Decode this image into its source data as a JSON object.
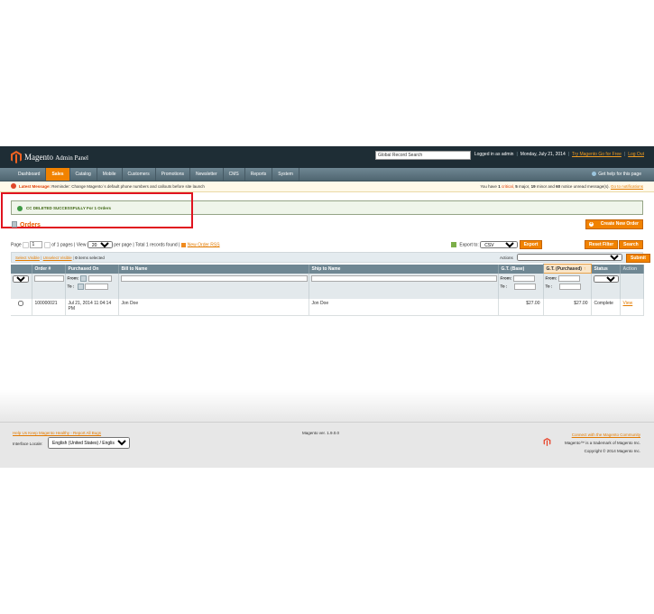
{
  "header": {
    "brand": "Magento",
    "brand_sub": "Admin Panel",
    "search_value": "Global Record Search",
    "logged_in": "Logged in as admin",
    "date": "Monday, July 21, 2014",
    "try_link": "Try Magento Go for Free",
    "logout": "Log Out"
  },
  "nav": {
    "items": [
      "Dashboard",
      "Sales",
      "Catalog",
      "Mobile",
      "Customers",
      "Promotions",
      "Newsletter",
      "CMS",
      "Reports",
      "System"
    ],
    "active": "Sales",
    "help": "Get help for this page"
  },
  "notice": {
    "label": "Latest Message:",
    "text": "Reminder: Change Magento`s default phone numbers and callouts before site launch",
    "right_prefix": "You have",
    "critical_count": "1",
    "critical_label": "critical,",
    "major_count": "5",
    "major_label": "major,",
    "minor_count": "19",
    "minor_label": "minor and",
    "notice_count": "60",
    "notice_label": "notice unread message(s).",
    "goto_link": "Go to notifications"
  },
  "success_message": "CC DELETED SUCCESSFULLY For 1 Orders",
  "page": {
    "title": "Orders",
    "create_button": "Create New Order"
  },
  "pager": {
    "page_label": "Page",
    "page_value": "1",
    "of_pages": "of 1 pages",
    "view_label": "View",
    "per_page_value": "20",
    "per_page_label": "per page",
    "records": "Total 1 records found",
    "rss_link": "New Order RSS"
  },
  "export": {
    "label": "Export to:",
    "format": "CSV",
    "button": "Export"
  },
  "buttons": {
    "reset": "Reset Filter",
    "search": "Search",
    "submit": "Submit"
  },
  "massaction": {
    "select_visible": "Select Visible",
    "unselect_visible": "Unselect Visible",
    "items_selected_count": "0",
    "items_selected_label": "items selected",
    "actions_label": "Actions",
    "actions_value": ""
  },
  "grid": {
    "columns": [
      "",
      "Order #",
      "Purchased On",
      "Bill to Name",
      "Ship to Name",
      "G.T. (Base)",
      "G.T. (Purchased)",
      "Status",
      "Action"
    ],
    "filter_any": "Any",
    "from_label": "From:",
    "to_label": "To :",
    "rows": [
      {
        "order": "100000021",
        "purchased_on": "Jul 21, 2014 11:04:14 PM",
        "bill_to": "Jon Doe",
        "ship_to": "Jon Doe",
        "gt_base": "$27.00",
        "gt_purchased": "$27.00",
        "status": "Complete",
        "action": "View"
      }
    ]
  },
  "footer": {
    "help_link": "Help Us Keep Magento Healthy - Report All Bugs",
    "locale_label": "Interface Locale:",
    "locale_value": "English (United States) / English",
    "version": "Magento ver. 1.9.0.0",
    "community_link": "Connect with the Magento Community",
    "trademark": "Magento™ is a trademark of Magento Inc.",
    "copyright": "Copyright © 2014 Magento Inc."
  },
  "colors": {
    "header_bg": "#1e2d35",
    "accent": "#f18200",
    "highlight_box": "#e0131f"
  }
}
